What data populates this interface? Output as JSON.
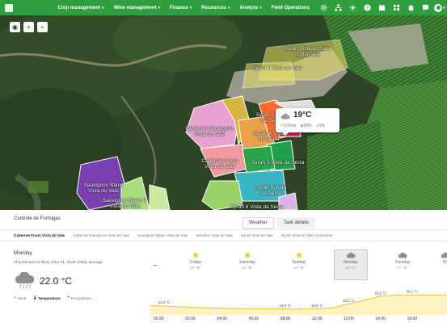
{
  "nav": {
    "menu": [
      {
        "label": "Crop management"
      },
      {
        "label": "Wine management"
      },
      {
        "label": "Finance"
      },
      {
        "label": "Resources"
      },
      {
        "label": "Analyze"
      },
      {
        "label": "Field Operations"
      }
    ],
    "colors": {
      "bar": "#2e9e3e"
    }
  },
  "map": {
    "fields": [
      {
        "label": "Syrah Vista do Vale (Inclusões)"
      },
      {
        "label": "Syrah 1 Vista do Vale"
      },
      {
        "label": "Syrah 2 Vista da Serra"
      },
      {
        "label": "Cabernet Sauvignon Vista do Vale"
      },
      {
        "label": "Syrah 4 Vista da Serra"
      },
      {
        "label": "Cabernet Franc Vista do Vale"
      },
      {
        "label": "Syrah 3 Vista da Serra"
      },
      {
        "label": "Sauvignon Blanc Vista do Vale"
      },
      {
        "label": "Syrah 5 Vista da Serra"
      },
      {
        "label": "Sauvignon Blanc 2 Vista do Vale"
      },
      {
        "label": "Syrah 6 Vista da Serra"
      }
    ],
    "popup": {
      "temp": "19°C",
      "rain": "0.0mm",
      "humidity": "59%",
      "wind": "0%"
    }
  },
  "panel": {
    "title": "Controle de Formigas",
    "tabs": [
      {
        "label": "Weather",
        "active": true
      },
      {
        "label": "Task details",
        "active": false
      }
    ],
    "fields": [
      {
        "label": "Cabernet Franc Vista do Vale",
        "active": true
      },
      {
        "label": "Cabernet Sauvignon Vista do Vale",
        "active": false
      },
      {
        "label": "Sauvignon Blanc Vista do Vale",
        "active": false
      },
      {
        "label": "Sémillon Vista do Vale",
        "active": false
      },
      {
        "label": "Syrah Vista do Vale",
        "active": false
      },
      {
        "label": "Syrah Vista do Vale (Inclusões)",
        "active": false
      }
    ],
    "day": "Monday",
    "location_line": "Thunderstorms likely  |  Mar 31, 2025  |  Daily average",
    "current_temp": "22.0 °C",
    "metrics": [
      {
        "label": "Wind",
        "active": false
      },
      {
        "label": "Temperature",
        "active": true
      },
      {
        "label": "Precipitation",
        "active": false
      }
    ],
    "forecast": [
      {
        "day": "Friday",
        "range": "15° 29°",
        "icon": "sun-icon"
      },
      {
        "day": "Saturday",
        "range": "15° 29°",
        "icon": "sun-icon"
      },
      {
        "day": "Sunday",
        "range": "18° 29°",
        "icon": "sun-icon"
      },
      {
        "day": "Monday",
        "range": "19° 27°",
        "icon": "cloud-icon",
        "active": true
      },
      {
        "day": "Tuesday",
        "range": "17° 25°",
        "icon": "cloud-icon"
      },
      {
        "day": "W",
        "range": "",
        "icon": "cloud-icon"
      }
    ]
  },
  "chart_data": {
    "type": "area",
    "title": "",
    "xlabel": "",
    "ylabel": "",
    "x": [
      "00:00",
      "01:00",
      "02:00",
      "03:00",
      "04:00",
      "05:00",
      "06:00",
      "07:00",
      "08:00",
      "09:00",
      "10:00",
      "11:00",
      "12:00",
      "13:00",
      "14:00",
      "15:00",
      "16:00",
      "17:00"
    ],
    "x_ticks": [
      "00:00",
      "02:00",
      "04:00",
      "06:00",
      "08:00",
      "10:00",
      "12:00",
      "14:00",
      "16:00"
    ],
    "values": [
      22.0,
      21.3,
      20.8,
      20.4,
      20.1,
      19.8,
      19.6,
      19.5,
      19.5,
      19.4,
      19.6,
      20.4,
      23.3,
      26.3,
      29.2,
      30.1,
      30.2,
      30.2
    ],
    "data_labels": [
      {
        "x": "00:00",
        "text": "22.0 °C"
      },
      {
        "x": "08:00",
        "text": "19.5 °C"
      },
      {
        "x": "10:00",
        "text": "19.6 °C"
      },
      {
        "x": "12:00",
        "text": "23.3 °C"
      },
      {
        "x": "14:00",
        "text": "29.2 °C"
      },
      {
        "x": "16:00",
        "text": "30.2 °C"
      }
    ],
    "ylim": [
      15,
      34
    ],
    "colors": {
      "fill": "#fdf3c2",
      "line": "#f2c12e"
    }
  }
}
